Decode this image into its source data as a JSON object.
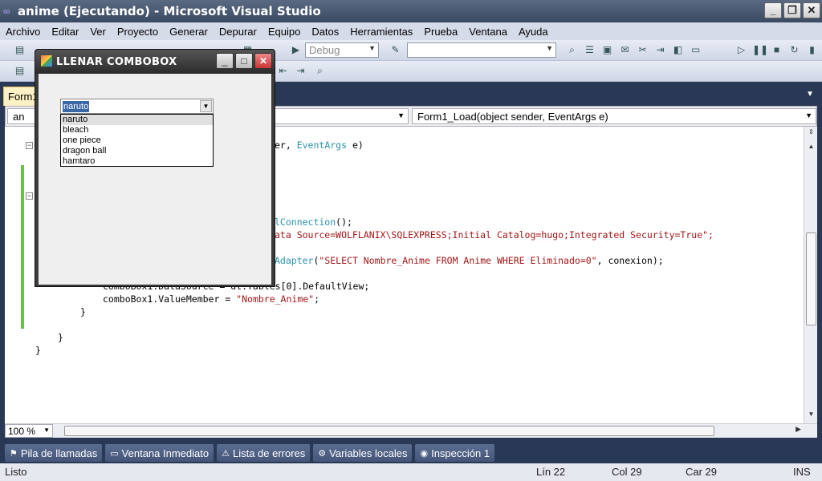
{
  "window": {
    "title": "anime (Ejecutando) - Microsoft Visual Studio",
    "controls": [
      "_",
      "❐",
      "✕"
    ]
  },
  "menu": [
    "Archivo",
    "Editar",
    "Ver",
    "Proyecto",
    "Generar",
    "Depurar",
    "Equipo",
    "Datos",
    "Herramientas",
    "Prueba",
    "Ventana",
    "Ayuda"
  ],
  "toolbar": {
    "config_combo": "Debug",
    "search_combo": ""
  },
  "document": {
    "tab_label": "Form1",
    "class_combo": "an",
    "method_combo": "Form1_Load(object sender, EventArgs e)",
    "zoom": "100 %"
  },
  "code": {
    "line1a": "er, ",
    "line1b": "EventArgs",
    "line1c": " e)",
    "line2a": "lConnection",
    "line2b": "();",
    "line3": "ata Source=WOLFLANIX\\SQLEXPRESS;Initial Catalog=hugo;Integrated Security=True\";",
    "line4a": "Adapter",
    "line4b": "(",
    "line4c": "\"SELECT Nombre_Anime FROM Anime WHERE Eliminado=0\"",
    "line4d": ", conexion);",
    "line5": "comboBox1.DataSource = dt.Tables[0].DefaultView;",
    "line6a": "comboBox1.ValueMember = ",
    "line6b": "\"Nombre_Anime\"",
    "line6c": ";",
    "brace1": "}",
    "brace2": "}",
    "brace3": "}"
  },
  "form": {
    "title": "LLENAR COMBOBOX",
    "combo_value": "naruto",
    "options": [
      "naruto",
      "bleach",
      "one piece",
      "dragon ball",
      "hamtaro"
    ]
  },
  "bottom_tabs": [
    "Pila de llamadas",
    "Ventana Inmediato",
    "Lista de errores",
    "Variables locales",
    "Inspección 1"
  ],
  "status": {
    "message": "Listo",
    "line": "Lín 22",
    "col": "Col 29",
    "char": "Car 29",
    "mode": "INS"
  }
}
